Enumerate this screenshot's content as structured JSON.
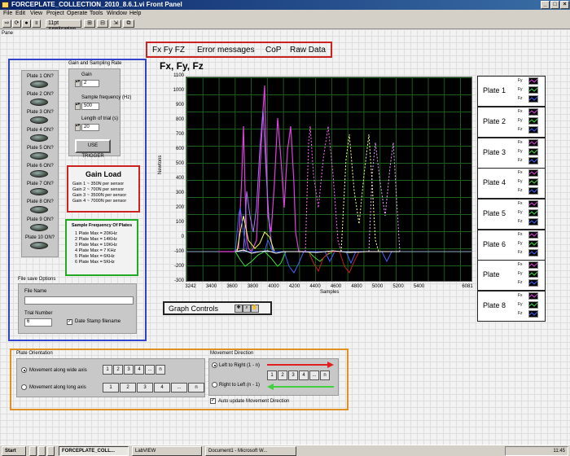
{
  "window": {
    "title": "FORCEPLATE_COLLECTION_2010_8.6.1.vi Front Panel"
  },
  "menu": [
    "File",
    "Edit",
    "View",
    "Project",
    "Operate",
    "Tools",
    "Window",
    "Help"
  ],
  "toolbar": {
    "font": "11pt Application Font"
  },
  "pane_label": "Pane",
  "tabs": [
    "Fx Fy FZ",
    "Error messages",
    "CoP",
    "Raw Data"
  ],
  "plates_on": [
    "Plate 1 ON?",
    "Plate 2 ON?",
    "Plate 3 ON?",
    "Plate 4 ON?",
    "Plate 5 ON?",
    "Plate 6 ON?",
    "Plate 7 ON?",
    "Plate 8 ON?",
    "Plate 9 ON?",
    "Plate 10 ON?"
  ],
  "gain_sampling": {
    "title": "Gain and Sampling Rate",
    "gain_label": "Gain",
    "gain_value": "2",
    "freq_label": "Sample frequency (Hz)",
    "freq_value": "500",
    "length_label": "Length of trial (s)",
    "length_value": "20",
    "trigger_button": "USE TRIGGER"
  },
  "gain_load": {
    "title": "Gain Load",
    "lines": [
      "Gain 1 ~ 350N per sensor",
      "Gain 2 ~ 700N per sensor",
      "Gain 3 ~ 3500N per sensor",
      "Gain 4 ~ 7000N per sensor"
    ]
  },
  "sample_freq": {
    "title": "Sample Frequency Of Plates",
    "lines": [
      "1 Plate Max = 20KHz",
      "2 Plate Max = 14KHz",
      "3 Plate Max = 10KHz",
      "4 Plate Max = 7 KHz",
      "5 Plate Max = 6KHz",
      "6 Plate Max = 5KHz"
    ]
  },
  "file_save": {
    "title": "File save Options",
    "file_name_label": "File Name",
    "file_name_value": "",
    "trial_label": "Trial Number",
    "trial_value": "6",
    "date_stamp_label": "Date Stamp filename"
  },
  "chart_data": {
    "type": "line",
    "title": "Fx, Fy, Fz",
    "xlabel": "Samples",
    "ylabel": "Newtons",
    "xlim": [
      3242,
      6081
    ],
    "ylim": [
      -300,
      1100
    ],
    "x_ticks": [
      3242,
      3400,
      3600,
      3800,
      4000,
      4200,
      4400,
      4600,
      4800,
      5000,
      5200,
      5400,
      6081
    ],
    "y_ticks": [
      1100,
      1000,
      900,
      800,
      700,
      600,
      500,
      400,
      300,
      200,
      100,
      0,
      -100,
      -200,
      -300
    ],
    "grid": true,
    "colors": {
      "magenta": "#e040e0",
      "violet": "#b070ff",
      "yellow": "#ffff60",
      "green": "#40e040",
      "blue": "#4060ff",
      "red": "#c02020",
      "white": "#ffffff",
      "dotted_magenta": "#ff66ff"
    }
  },
  "graph_controls": {
    "label": "Graph Controls"
  },
  "plates": [
    {
      "name": "Plate 1",
      "legend": [
        "Fy",
        "Fy",
        "Fz"
      ]
    },
    {
      "name": "Plate 2",
      "legend": [
        "Fx",
        "Fy",
        "Fz"
      ]
    },
    {
      "name": "Plate 3",
      "legend": [
        "Fx",
        "Fy",
        "Fz"
      ]
    },
    {
      "name": "Plate 4",
      "legend": [
        "Fx",
        "Fy",
        "Fz"
      ]
    },
    {
      "name": "Plate 5",
      "legend": [
        "Fx",
        "Fy",
        "Fz"
      ]
    },
    {
      "name": "Plate 6",
      "legend": [
        "Fx",
        "Fy",
        "Fz"
      ]
    },
    {
      "name": "Plate",
      "legend": [
        "Fx",
        "Fy",
        "Fz"
      ]
    },
    {
      "name": "Plate 8",
      "legend": [
        "Fx",
        "Fy",
        "Fz"
      ]
    }
  ],
  "plate_orientation": {
    "title": "Plate Orientation",
    "option_wide": "Movement along wide axis",
    "option_long": "Movement along long axis",
    "seq_wide": [
      "1",
      "2",
      "3",
      "4",
      "...",
      "n"
    ],
    "seq_long": [
      "1",
      "2",
      "3",
      "4",
      "...",
      "n"
    ]
  },
  "movement_direction": {
    "title": "Movement Direction",
    "option_ltr": "Left to Right (1 - n)",
    "option_rtl": "Right to Left (n - 1)",
    "seq": [
      "1",
      "2",
      "3",
      "4",
      "...",
      "n"
    ],
    "auto_update_label": "Auto update Movement Direction"
  },
  "taskbar": {
    "start": "Start",
    "tasks": [
      "FORCEPLATE_COLL...",
      "LabVIEW",
      "Document1 - Microsoft W..."
    ],
    "clock": "11:45"
  }
}
